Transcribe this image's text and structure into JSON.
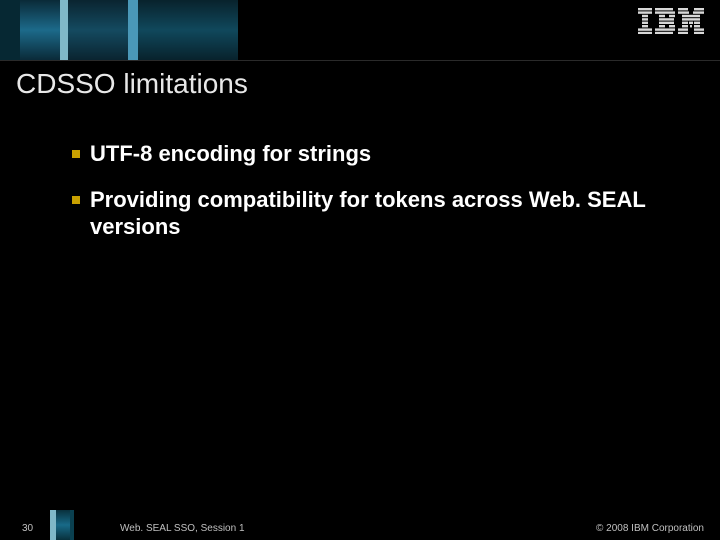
{
  "header": {
    "logo_label": "IBM"
  },
  "slide": {
    "title": "CDSSO limitations",
    "bullets": [
      "UTF-8 encoding for strings",
      "Providing compatibility for tokens across Web. SEAL versions"
    ]
  },
  "footer": {
    "page_number": "30",
    "session": "Web. SEAL SSO, Session 1",
    "copyright": "© 2008 IBM Corporation"
  },
  "colors": {
    "background": "#000000",
    "title_text": "#e8e8e8",
    "bullet_text": "#ffffff",
    "bullet_marker": "#c8a000",
    "accent_teal": "#1c6a8a"
  }
}
